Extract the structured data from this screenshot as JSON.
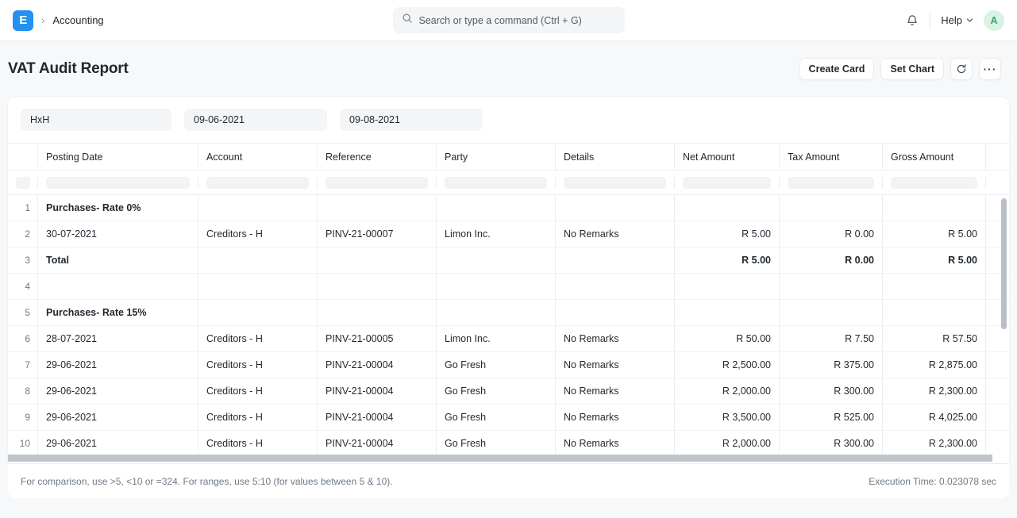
{
  "navbar": {
    "logo_letter": "E",
    "breadcrumb_separator": "›",
    "breadcrumb": "Accounting",
    "search_placeholder": "Search or type a command (Ctrl + G)",
    "search_value": "",
    "notification_icon": "bell-icon",
    "help_label": "Help",
    "avatar_initial": "A",
    "avatar_bg": "#d8f3e3",
    "avatar_color": "#30a66d",
    "brand_color": "#2490ef"
  },
  "page": {
    "title": "VAT Audit Report",
    "actions": {
      "create_card": "Create Card",
      "set_chart": "Set Chart",
      "refresh_icon": "refresh-icon",
      "menu_icon": "ellipsis-icon",
      "menu_label": "···"
    }
  },
  "filters": [
    {
      "name": "company",
      "value": "HxH",
      "placeholder": "Company"
    },
    {
      "name": "from-date",
      "value": "09-06-2021",
      "placeholder": "From Date"
    },
    {
      "name": "to-date",
      "value": "09-08-2021",
      "placeholder": "To Date"
    }
  ],
  "table": {
    "columns": [
      "Posting Date",
      "Account",
      "Reference",
      "Party",
      "Details",
      "Net Amount",
      "Tax Amount",
      "Gross Amount"
    ],
    "filter_row_placeholders": [
      "",
      "",
      "",
      "",
      "",
      "",
      "",
      ""
    ],
    "rows": [
      {
        "idx": "1",
        "bold": true,
        "posting_date": "Purchases- Rate 0%",
        "account": "",
        "reference": "",
        "party": "",
        "details": "",
        "net": "",
        "tax": "",
        "gross": ""
      },
      {
        "idx": "2",
        "bold": false,
        "posting_date": "30-07-2021",
        "account": "Creditors - H",
        "reference": "PINV-21-00007",
        "party": "Limon Inc.",
        "details": "No Remarks",
        "net": "R 5.00",
        "tax": "R 0.00",
        "gross": "R 5.00"
      },
      {
        "idx": "3",
        "bold": true,
        "posting_date": "Total",
        "account": "",
        "reference": "",
        "party": "",
        "details": "",
        "net": "R 5.00",
        "tax": "R 0.00",
        "gross": "R 5.00"
      },
      {
        "idx": "4",
        "bold": false,
        "posting_date": "",
        "account": "",
        "reference": "",
        "party": "",
        "details": "",
        "net": "",
        "tax": "",
        "gross": ""
      },
      {
        "idx": "5",
        "bold": true,
        "posting_date": "Purchases- Rate 15%",
        "account": "",
        "reference": "",
        "party": "",
        "details": "",
        "net": "",
        "tax": "",
        "gross": ""
      },
      {
        "idx": "6",
        "bold": false,
        "posting_date": "28-07-2021",
        "account": "Creditors - H",
        "reference": "PINV-21-00005",
        "party": "Limon Inc.",
        "details": "No Remarks",
        "net": "R 50.00",
        "tax": "R 7.50",
        "gross": "R 57.50"
      },
      {
        "idx": "7",
        "bold": false,
        "posting_date": "29-06-2021",
        "account": "Creditors - H",
        "reference": "PINV-21-00004",
        "party": "Go Fresh",
        "details": "No Remarks",
        "net": "R 2,500.00",
        "tax": "R 375.00",
        "gross": "R 2,875.00"
      },
      {
        "idx": "8",
        "bold": false,
        "posting_date": "29-06-2021",
        "account": "Creditors - H",
        "reference": "PINV-21-00004",
        "party": "Go Fresh",
        "details": "No Remarks",
        "net": "R 2,000.00",
        "tax": "R 300.00",
        "gross": "R 2,300.00"
      },
      {
        "idx": "9",
        "bold": false,
        "posting_date": "29-06-2021",
        "account": "Creditors - H",
        "reference": "PINV-21-00004",
        "party": "Go Fresh",
        "details": "No Remarks",
        "net": "R 3,500.00",
        "tax": "R 525.00",
        "gross": "R 4,025.00"
      },
      {
        "idx": "10",
        "bold": false,
        "posting_date": "29-06-2021",
        "account": "Creditors - H",
        "reference": "PINV-21-00004",
        "party": "Go Fresh",
        "details": "No Remarks",
        "net": "R 2,000.00",
        "tax": "R 300.00",
        "gross": "R 2,300.00"
      }
    ]
  },
  "footer": {
    "hint": "For comparison, use >5, <10 or =324. For ranges, use 5:10 (for values between 5 & 10).",
    "execution_time": "Execution Time: 0.023078 sec"
  }
}
